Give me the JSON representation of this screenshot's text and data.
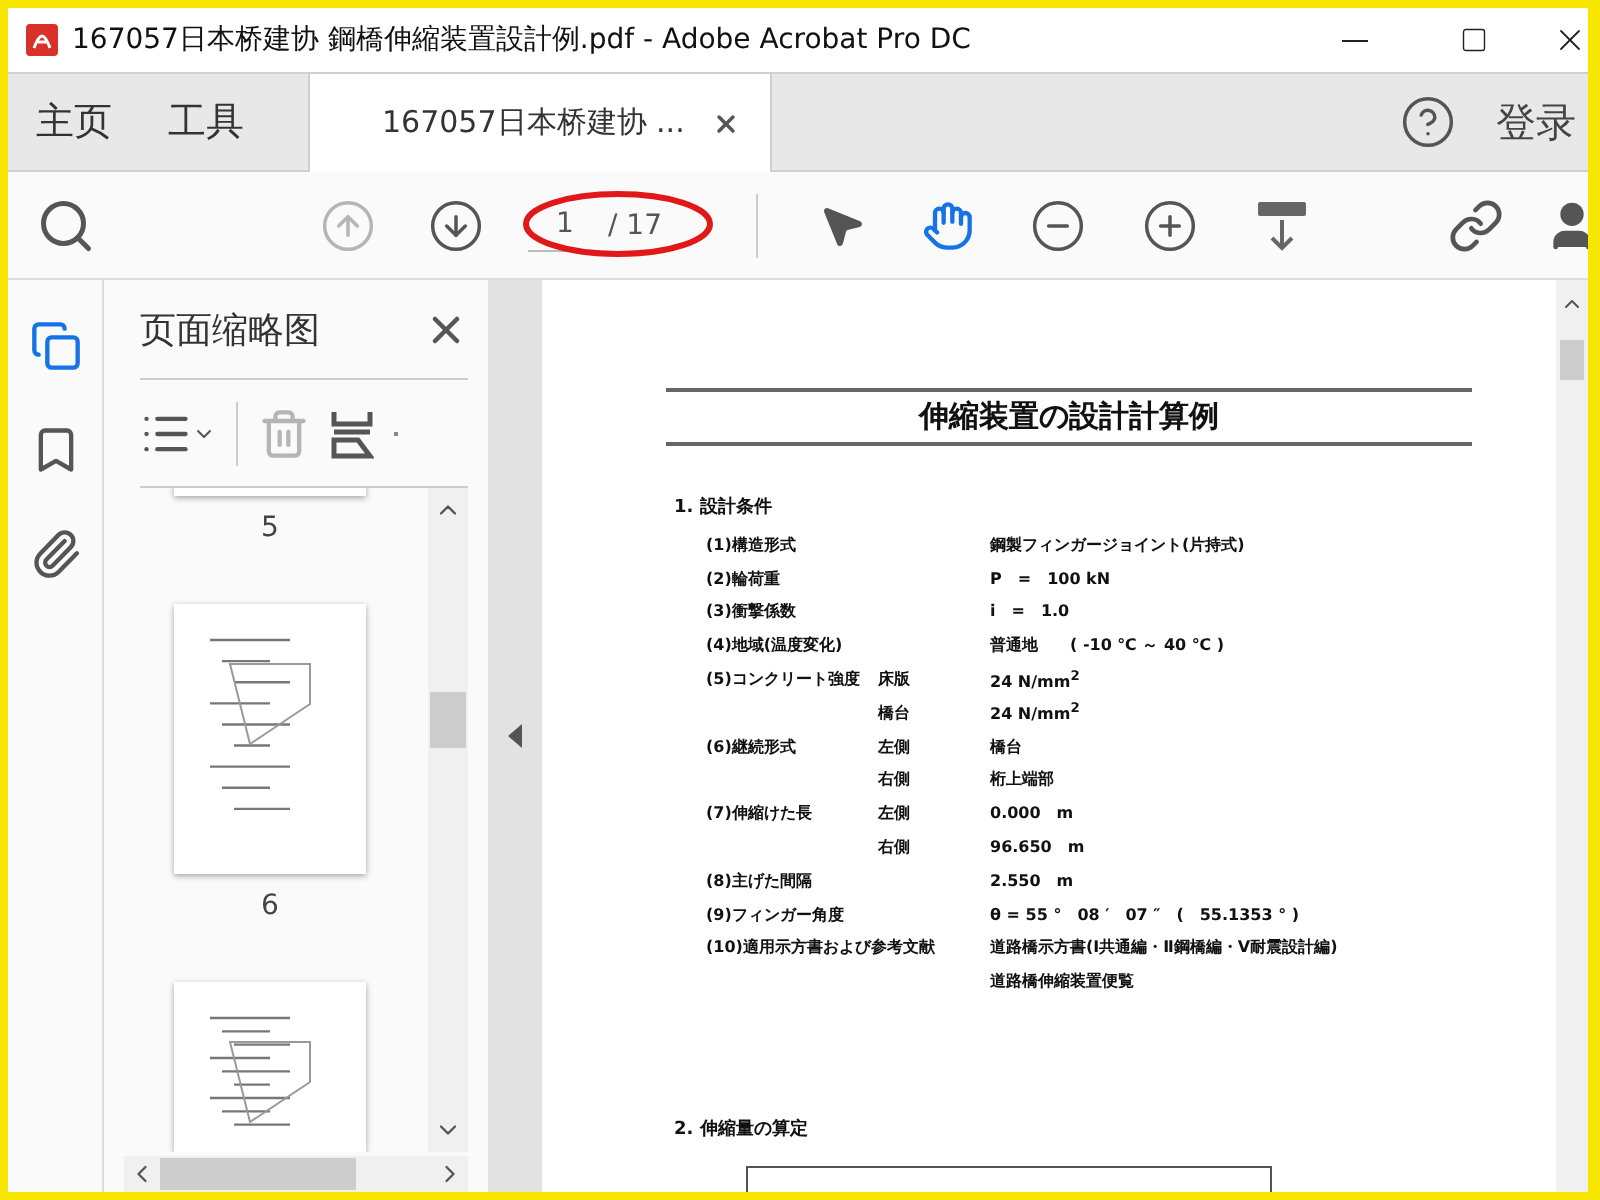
{
  "window": {
    "title": "167057日本桥建协 鋼橋伸縮装置設計例.pdf - Adobe Acrobat Pro DC"
  },
  "tabs": [
    {
      "label": "主页",
      "selected": false,
      "kind": "nav"
    },
    {
      "label": "工具",
      "selected": false,
      "kind": "nav"
    },
    {
      "label": "167057日本桥建协 ...",
      "selected": true,
      "kind": "document"
    }
  ],
  "sign_in": "登录",
  "toolbar": {
    "page_number": "1",
    "page_count": "/ 17",
    "tools": [
      {
        "selected": false
      },
      {
        "selected": true
      }
    ]
  },
  "sidebar": {
    "items": [
      {
        "selected": true
      },
      {
        "selected": false
      },
      {
        "selected": false
      }
    ]
  },
  "thumbnails_panel": {
    "title": "页面缩略图",
    "pages": [
      {
        "label": "5",
        "kind": "partial"
      },
      {
        "label": "6",
        "kind": "full"
      }
    ]
  },
  "document": {
    "title": "伸縮装置の設計計算例",
    "sections": [
      {
        "heading": "1. 設計条件",
        "rows": [
          {
            "label": "(1)構造形式",
            "sub": "",
            "value": "鋼製フィンガージョイント(片持式)"
          },
          {
            "label": "(2)輪荷重",
            "sub": "",
            "value": "P　=　100 kN"
          },
          {
            "label": "(3)衝撃係数",
            "sub": "",
            "value": "i　=　1.0"
          },
          {
            "label": "(4)地域(温度変化)",
            "sub": "",
            "value": "普通地　　( -10 ℃ ～ 40 ℃ )"
          },
          {
            "label": "(5)コンクリート強度",
            "sub": "床版",
            "value": "24 N/mm$^{2}$"
          },
          {
            "label": "",
            "sub": "橋台",
            "value": "24 N/mm$^{2}$"
          },
          {
            "label": "(6)継続形式",
            "sub": "左側",
            "value": "橋台"
          },
          {
            "label": "",
            "sub": "右側",
            "value": "桁上端部"
          },
          {
            "label": "(7)伸縮けた長",
            "sub": "左側",
            "value": "0.000　m"
          },
          {
            "label": "",
            "sub": "右側",
            "value": "96.650　m"
          },
          {
            "label": "(8)主げた間隔",
            "sub": "",
            "value": "2.550　m"
          },
          {
            "label": "(9)フィンガー角度",
            "sub": "",
            "value": "θ = 55 °　08 ′　07 ″　(　55.1353 ° )"
          },
          {
            "label": "(10)適用示方書および参考文献",
            "sub": "",
            "value": "道路橋示方書(Ⅰ共通編・Ⅱ鋼橋編・Ⅴ耐震設計編)"
          },
          {
            "label": "",
            "sub": "",
            "value": "道路橋伸縮装置便覧"
          }
        ]
      },
      {
        "heading": "2. 伸縮量の算定"
      }
    ]
  }
}
